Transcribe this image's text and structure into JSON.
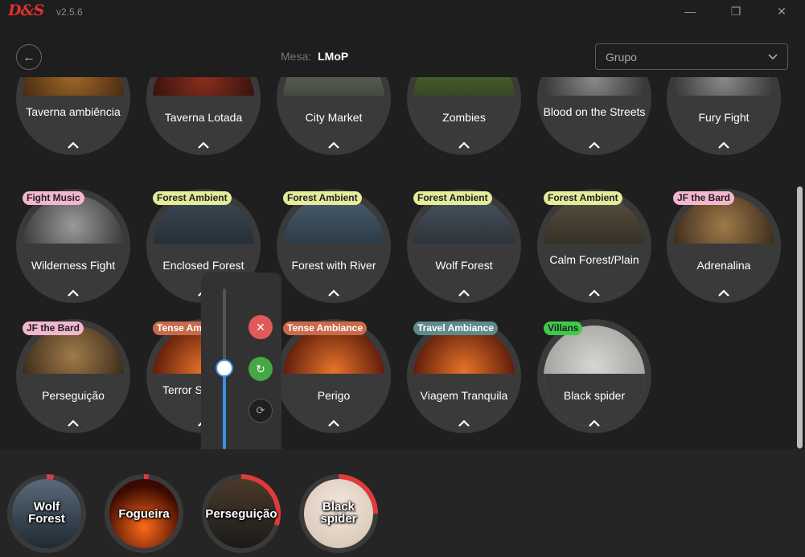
{
  "app": {
    "logo": "D&S",
    "version": "v2.5.6"
  },
  "window": {
    "minimize": "—",
    "maximize": "❐",
    "close": "✕"
  },
  "header": {
    "back_icon": "←",
    "mesa_label": "Mesa:",
    "mesa_value": "LMoP",
    "group_select": {
      "value": "Grupo"
    }
  },
  "tiles": [
    {
      "title": "Taverna ambiência",
      "tag": "",
      "tag_color": "#6fd18c"
    },
    {
      "title": "Taverna Lotada",
      "tag": "",
      "tag_color": "#6fd18c"
    },
    {
      "title": "City Market",
      "tag": "",
      "tag_color": "#a58be0"
    },
    {
      "title": "Zombies",
      "tag": "",
      "tag_color": "#e9882d"
    },
    {
      "title": "Blood on the Streets",
      "tag": "",
      "tag_color": "#f3b6cf"
    },
    {
      "title": "Fury Fight",
      "tag": "",
      "tag_color": "#f3b6cf"
    },
    {
      "title": "Wilderness Fight",
      "tag": "Fight Music",
      "tag_color": "#f3b6cf"
    },
    {
      "title": "Enclosed Forest",
      "tag": "Forest Ambient",
      "tag_color": "#e4eb9a"
    },
    {
      "title": "Forest with River",
      "tag": "Forest Ambient",
      "tag_color": "#e4eb9a"
    },
    {
      "title": "Wolf Forest",
      "tag": "Forest Ambient",
      "tag_color": "#e4eb9a"
    },
    {
      "title": "Calm Forest/Plain",
      "tag": "Forest Ambient",
      "tag_color": "#e4eb9a"
    },
    {
      "title": "Adrenalina",
      "tag": "JF the Bard",
      "tag_color": "#f3b6cf"
    },
    {
      "title": "Perseguição",
      "tag": "JF the Bard",
      "tag_color": "#f3b6cf"
    },
    {
      "title": "Terror Sorrateiro",
      "tag": "Tense Ambiance",
      "tag_color": "#c96a4a"
    },
    {
      "title": "Perigo",
      "tag": "Tense Ambiance",
      "tag_color": "#c96a4a"
    },
    {
      "title": "Viagem Tranquila",
      "tag": "Travel Ambiance",
      "tag_color": "#5f8a8d"
    },
    {
      "title": "Black spider",
      "tag": "Villans",
      "tag_color": "#3fca4a"
    }
  ],
  "volume_popup": {
    "volume": 0.5,
    "close_icon": "✕",
    "refresh_icon": "↻",
    "loop_icon": "⟳"
  },
  "playing": [
    {
      "label": "Wolf Forest",
      "progress": 0.03
    },
    {
      "label": "Fogueira",
      "progress": 0.02
    },
    {
      "label": "Perseguição",
      "progress": 0.3
    },
    {
      "label": "Black spider",
      "progress": 0.25
    }
  ],
  "colors": {
    "accent_blue": "#3c8ee0",
    "close_red": "#e05a5a",
    "refresh_green": "#45a845",
    "progress_red": "#e03a3a"
  }
}
